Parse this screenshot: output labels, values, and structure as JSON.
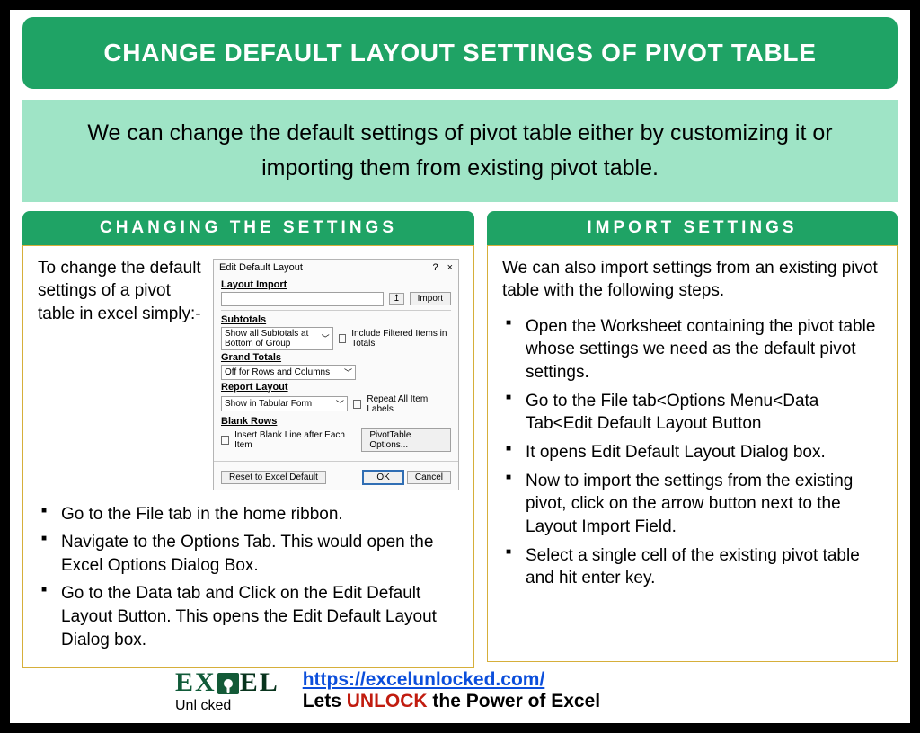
{
  "title": "CHANGE DEFAULT LAYOUT SETTINGS OF PIVOT TABLE",
  "intro": "We can change the default settings of pivot table either by customizing it or importing them from existing pivot table.",
  "colors": {
    "accent": "#1fa365",
    "intro_bg": "#9fe4c6",
    "border": "#d6af3a"
  },
  "left": {
    "header": "CHANGING THE SETTINGS",
    "lead": "To change the default settings of a pivot table in excel simply:-",
    "bullets": [
      "Go to the File tab in the home ribbon.",
      "Navigate to the Options Tab. This would open the Excel Options Dialog Box.",
      "Go to the Data tab and Click on the Edit Default Layout Button. This opens the Edit Default Layout Dialog box."
    ]
  },
  "right": {
    "header": "IMPORT SETTINGS",
    "lead": "We can also import settings from an existing pivot table with the following steps.",
    "bullets": [
      "Open the Worksheet containing the pivot table whose settings we need as the default pivot settings.",
      "Go to the File tab<Options Menu<Data Tab<Edit Default Layout Button",
      "It opens Edit Default Layout Dialog box.",
      "Now to import the settings from the existing pivot, click on the arrow button next to the Layout Import Field.",
      "Select a single cell of the existing pivot table and hit enter key."
    ]
  },
  "dialog": {
    "title": "Edit Default Layout",
    "help": "?",
    "close": "×",
    "layout_import_label": "Layout Import",
    "import_btn": "Import",
    "subtotals_label": "Subtotals",
    "subtotals_value": "Show all Subtotals at Bottom of Group",
    "include_filtered": "Include Filtered Items in Totals",
    "grand_totals_label": "Grand Totals",
    "grand_totals_value": "Off for Rows and Columns",
    "report_layout_label": "Report Layout",
    "report_layout_value": "Show in Tabular Form",
    "repeat_labels": "Repeat All Item Labels",
    "blank_rows_label": "Blank Rows",
    "blank_rows_check": "Insert Blank Line after Each Item",
    "pivot_options_btn": "PivotTable Options...",
    "reset_btn": "Reset to Excel Default",
    "ok_btn": "OK",
    "cancel_btn": "Cancel"
  },
  "footer": {
    "logo_top1": "EX",
    "logo_top2": "EL",
    "logo_bottom": "Unl   cked",
    "url": "https://excelunlocked.com/",
    "line_prefix": "Lets ",
    "unlock": "UNLOCK",
    "line_suffix": " the Power of Excel"
  }
}
